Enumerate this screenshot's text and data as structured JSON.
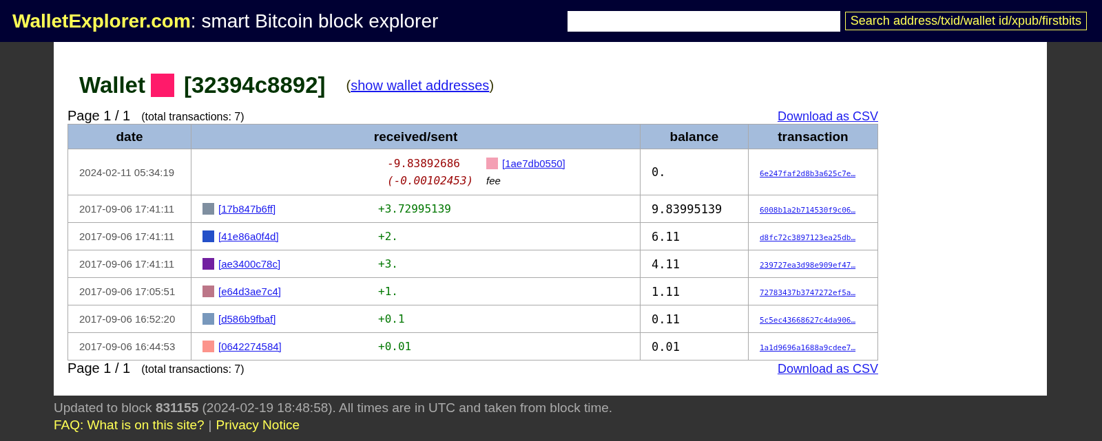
{
  "header": {
    "site_name": "WalletExplorer.com",
    "tagline": ": smart Bitcoin block explorer",
    "search_button": "Search address/txid/wallet id/xpub/firstbits"
  },
  "wallet": {
    "label": "Wallet",
    "color": "#ff1a6a",
    "id": "[32394c8892]",
    "open_paren": "(",
    "link": "show wallet addresses",
    "close_paren": ")"
  },
  "pager_top": {
    "page": "Page 1 / 1",
    "total": "(total transactions: 7)",
    "download": "Download as CSV"
  },
  "table": {
    "columns": [
      "date",
      "received/sent",
      "balance",
      "transaction"
    ],
    "rows": [
      {
        "kind": "sent",
        "date": "2024-02-11 05:34:19",
        "amount": "-9.83892686",
        "color": "#f4a0b4",
        "wallet": "[1ae7db0550]",
        "fee_amount": "(-0.00102453)",
        "fee_label": "fee",
        "balance": "0.",
        "tx": "6e247faf2d8b3a625c7e…"
      },
      {
        "kind": "received",
        "date": "2017-09-06 17:41:11",
        "amount": "+3.72995139",
        "color": "#7f8fa0",
        "wallet": "[17b847b6ff]",
        "balance": "9.83995139",
        "tx": "6008b1a2b714530f9c06…"
      },
      {
        "kind": "received",
        "date": "2017-09-06 17:41:11",
        "amount": "+2.",
        "color": "#2450c8",
        "wallet": "[41e86a0f4d]",
        "balance": "6.11",
        "tx": "d8fc72c3897123ea25db…"
      },
      {
        "kind": "received",
        "date": "2017-09-06 17:41:11",
        "amount": "+3.",
        "color": "#7220a0",
        "wallet": "[ae3400c78c]",
        "balance": "4.11",
        "tx": "239727ea3d98e909ef47…"
      },
      {
        "kind": "received",
        "date": "2017-09-06 17:05:51",
        "amount": "+1.",
        "color": "#bc7688",
        "wallet": "[e64d3ae7c4]",
        "balance": "1.11",
        "tx": "72783437b3747272ef5a…"
      },
      {
        "kind": "received",
        "date": "2017-09-06 16:52:20",
        "amount": "+0.1",
        "color": "#7898bc",
        "wallet": "[d586b9fbaf]",
        "balance": "0.11",
        "tx": "5c5ec43668627c4da906…"
      },
      {
        "kind": "received",
        "date": "2017-09-06 16:44:53",
        "amount": "+0.01",
        "color": "#fc948c",
        "wallet": "[0642274584]",
        "balance": "0.01",
        "tx": "1a1d9696a1688a9cdee7…"
      }
    ]
  },
  "pager_bottom": {
    "page": "Page 1 / 1",
    "total": "(total transactions: 7)",
    "download": "Download as CSV"
  },
  "footer": {
    "updated": "Updated to block **831155** (2024-02-19 18:48:58). All times are in UTC and taken from block time.",
    "faq_link": "FAQ: What is on this site?",
    "separator": "|",
    "privacy_link": "Privacy Notice"
  }
}
